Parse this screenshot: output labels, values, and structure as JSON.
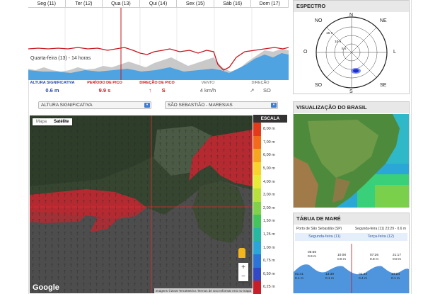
{
  "days": [
    "Seg (11)",
    "Ter (12)",
    "Qua (13)",
    "Qui (14)",
    "Sex (15)",
    "Sáb (16)",
    "Dom (17)"
  ],
  "chart_label": "Quarta-feira (13) - 14 horas",
  "values": [
    {
      "label": "ALTURA SIGNIFICATIVA",
      "value": "0.6 m",
      "color": "#2448a8"
    },
    {
      "label": "PERÍODO DE PICO",
      "value": "9.9 s",
      "color": "#cc1a1a"
    },
    {
      "label": "DIREÇÃO DE PICO",
      "value": "S",
      "arrow": "↑",
      "color": "#cc1a1a"
    },
    {
      "label": "VENTO",
      "value": "4 km/h",
      "color": "#666"
    },
    {
      "label": "DIREÇÃO",
      "value": "SO",
      "arrow": "↗",
      "color": "#666"
    }
  ],
  "select_left": "ALTURA SIGNIFICATIVA",
  "select_right": "SÃO SEBASTIÃO - MARESIAS",
  "map_tabs": [
    "Mapa",
    "Satélite"
  ],
  "map_attrib": "Imagens ©2016 TerraMetrics   Termos de Uso   Informar erro no mapa",
  "google": "Google",
  "scale": {
    "title": "ESCALA",
    "labels": [
      "8,00 m",
      "7,00 m",
      "6,00 m",
      "5,00 m",
      "4,00 m",
      "3,00 m",
      "2,00 m",
      "1,50 m",
      "1,25 m",
      "1,00 m",
      "0,75 m",
      "0,50 m",
      "0,25 m"
    ],
    "colors": [
      "#e23a1a",
      "#f36a1a",
      "#f7a51e",
      "#f9d22c",
      "#e6ec35",
      "#b8e03b",
      "#7fd24a",
      "#44c55c",
      "#27b8a0",
      "#2aa6d8",
      "#2b74d8",
      "#3248c4",
      "#c81e2a"
    ]
  },
  "spectro": {
    "title": "ESPECTRO",
    "rings": [
      "15 s",
      "10 s",
      "5 s"
    ],
    "dirs": [
      "NO",
      "N",
      "NE",
      "O",
      "L",
      "SO",
      "S",
      "SE"
    ]
  },
  "brasil": {
    "title": "VISUALIZAÇÃO DO BRASIL"
  },
  "tide": {
    "title": "TÁBUA DE MARÉ",
    "place": "Porto de São Sebastião (SP)",
    "now": "Segunda-feira (11) 23:29 - 0.6 m",
    "days": [
      "Segunda-feira (11)",
      "Terça-feira (12)"
    ],
    "highs": [
      {
        "t": "05:56",
        "h": "0.9 m"
      },
      {
        "t": "10:08",
        "h": "0.8 m"
      },
      {
        "t": "07:26",
        "h": "0.8 m"
      },
      {
        "t": "21:17",
        "h": "0.8 m"
      }
    ],
    "lows": [
      {
        "t": "01:41",
        "h": "0.1 m"
      },
      {
        "t": "13:39",
        "h": "0.1 m"
      },
      {
        "t": "02:34",
        "h": "0.4 m"
      },
      {
        "t": "14:24",
        "h": "0.1 m"
      }
    ]
  }
}
